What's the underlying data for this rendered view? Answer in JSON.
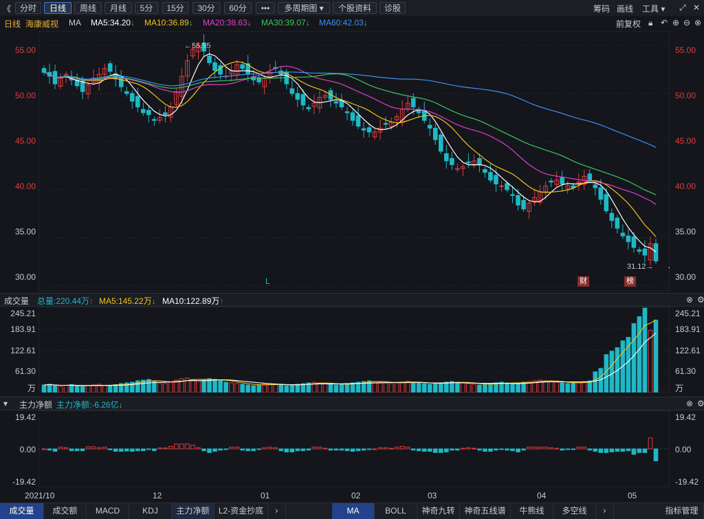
{
  "toolbar": {
    "back_icon": "《",
    "buttons": [
      "分时",
      "日线",
      "周线",
      "月线",
      "5分",
      "15分",
      "30分",
      "60分",
      "•••",
      "多周期图 ▾",
      "个股资料",
      "诊股"
    ],
    "active": "日线",
    "right": [
      "筹码",
      "画线",
      "工具 ▾"
    ],
    "expand_icon": "⤢",
    "close_icon": "✕"
  },
  "legend": {
    "period": "日线",
    "stock_name": "海康威视",
    "ma": "MA",
    "ma5": "MA5:34.20",
    "ma10": "MA10:36.89",
    "ma20": "MA20:38.63",
    "ma30": "MA30:39.07",
    "ma60": "MA60:42.03",
    "restore": "前复权",
    "colors": {
      "ma5": "#ffffff",
      "ma10": "#f5c518",
      "ma20": "#e040c8",
      "ma30": "#3ec85a",
      "ma60": "#3f8ff0",
      "up": "#e03c3c",
      "down": "#1fb8c6"
    }
  },
  "price_axis": [
    "55.00",
    "50.00",
    "45.00",
    "40.00",
    "35.00",
    "30.00"
  ],
  "annotations": {
    "high": "←55.55",
    "low": "31.12→",
    "marker_l": "L",
    "marker_cai": "财",
    "marker_bang": "榜"
  },
  "volume": {
    "title": "成交量",
    "total": "总量:220.44万",
    "ma5": "MA5:145.22万",
    "ma10": "MA10:122.89万",
    "axis": [
      "245.21",
      "183.91",
      "122.61",
      "61.30",
      "万"
    ]
  },
  "flow": {
    "title": "主力净额",
    "value": "主力净额:-6.26亿",
    "axis": [
      "19.42",
      "0.00",
      "-19.42"
    ]
  },
  "dates": [
    "2021/10",
    "12",
    "01",
    "02",
    "03",
    "04",
    "05"
  ],
  "bottom_tabs": [
    "成交量",
    "成交额",
    "MACD",
    "KDJ",
    "主力净额",
    "L2-资金抄底"
  ],
  "bottom_tabs_right": [
    "MA",
    "BOLL",
    "神奇九转",
    "神奇五线谱",
    "牛熊线",
    "多空线",
    "指标管理"
  ],
  "chart_data": {
    "type": "candlestick",
    "title": "海康威视 日线",
    "ylim": [
      29.5,
      56.5
    ],
    "ma_last": {
      "MA5": 34.2,
      "MA10": 36.89,
      "MA20": 38.63,
      "MA30": 39.07,
      "MA60": 42.03
    },
    "high": 55.55,
    "low": 31.12,
    "close_series": [
      52.2,
      51.8,
      51.0,
      51.6,
      52.0,
      51.4,
      50.8,
      50.2,
      50.9,
      51.6,
      52.0,
      52.6,
      52.3,
      51.5,
      50.7,
      50.0,
      49.2,
      48.6,
      48.0,
      47.8,
      47.2,
      47.5,
      47.8,
      48.6,
      50.2,
      51.8,
      53.4,
      54.6,
      55.0,
      54.4,
      53.2,
      52.4,
      52.0,
      51.8,
      52.4,
      53.0,
      52.6,
      52.0,
      51.4,
      51.2,
      51.6,
      52.2,
      52.6,
      52.0,
      51.0,
      50.0,
      49.4,
      48.8,
      48.4,
      49.0,
      49.6,
      49.8,
      49.4,
      49.0,
      48.6,
      48.0,
      47.2,
      46.6,
      46.2,
      46.0,
      46.0,
      46.4,
      46.8,
      47.0,
      47.6,
      48.4,
      49.0,
      48.6,
      48.0,
      47.2,
      46.4,
      45.2,
      44.0,
      43.0,
      42.6,
      42.2,
      42.4,
      42.8,
      43.0,
      42.6,
      41.8,
      41.0,
      40.6,
      40.4,
      40.0,
      39.4,
      38.4,
      38.0,
      38.6,
      39.2,
      39.8,
      40.4,
      40.8,
      41.0,
      40.6,
      40.4,
      40.2,
      40.8,
      41.4,
      41.0,
      40.2,
      39.0,
      37.8,
      36.8,
      36.0,
      35.2,
      34.6,
      34.0,
      33.6,
      33.2,
      34.4,
      32.6
    ],
    "volume_series": [
      22,
      24,
      20,
      18,
      21,
      23,
      19,
      17,
      20,
      22,
      24,
      21,
      19,
      23,
      26,
      28,
      30,
      34,
      36,
      38,
      32,
      28,
      26,
      30,
      36,
      40,
      42,
      38,
      34,
      36,
      40,
      38,
      34,
      30,
      28,
      26,
      24,
      22,
      20,
      22,
      24,
      26,
      24,
      22,
      20,
      22,
      24,
      26,
      28,
      30,
      28,
      26,
      24,
      22,
      24,
      26,
      28,
      30,
      32,
      34,
      32,
      30,
      28,
      26,
      28,
      30,
      32,
      30,
      28,
      26,
      24,
      26,
      28,
      30,
      32,
      30,
      28,
      26,
      24,
      22,
      24,
      26,
      28,
      30,
      28,
      26,
      28,
      30,
      32,
      34,
      36,
      34,
      32,
      30,
      28,
      26,
      28,
      30,
      32,
      34,
      60,
      70,
      110,
      120,
      130,
      150,
      160,
      200,
      220,
      245,
      180,
      210
    ],
    "volume_axis_max": 245.21,
    "flow_axis": [
      -19.42,
      19.42
    ],
    "flow_last": -6.26
  }
}
